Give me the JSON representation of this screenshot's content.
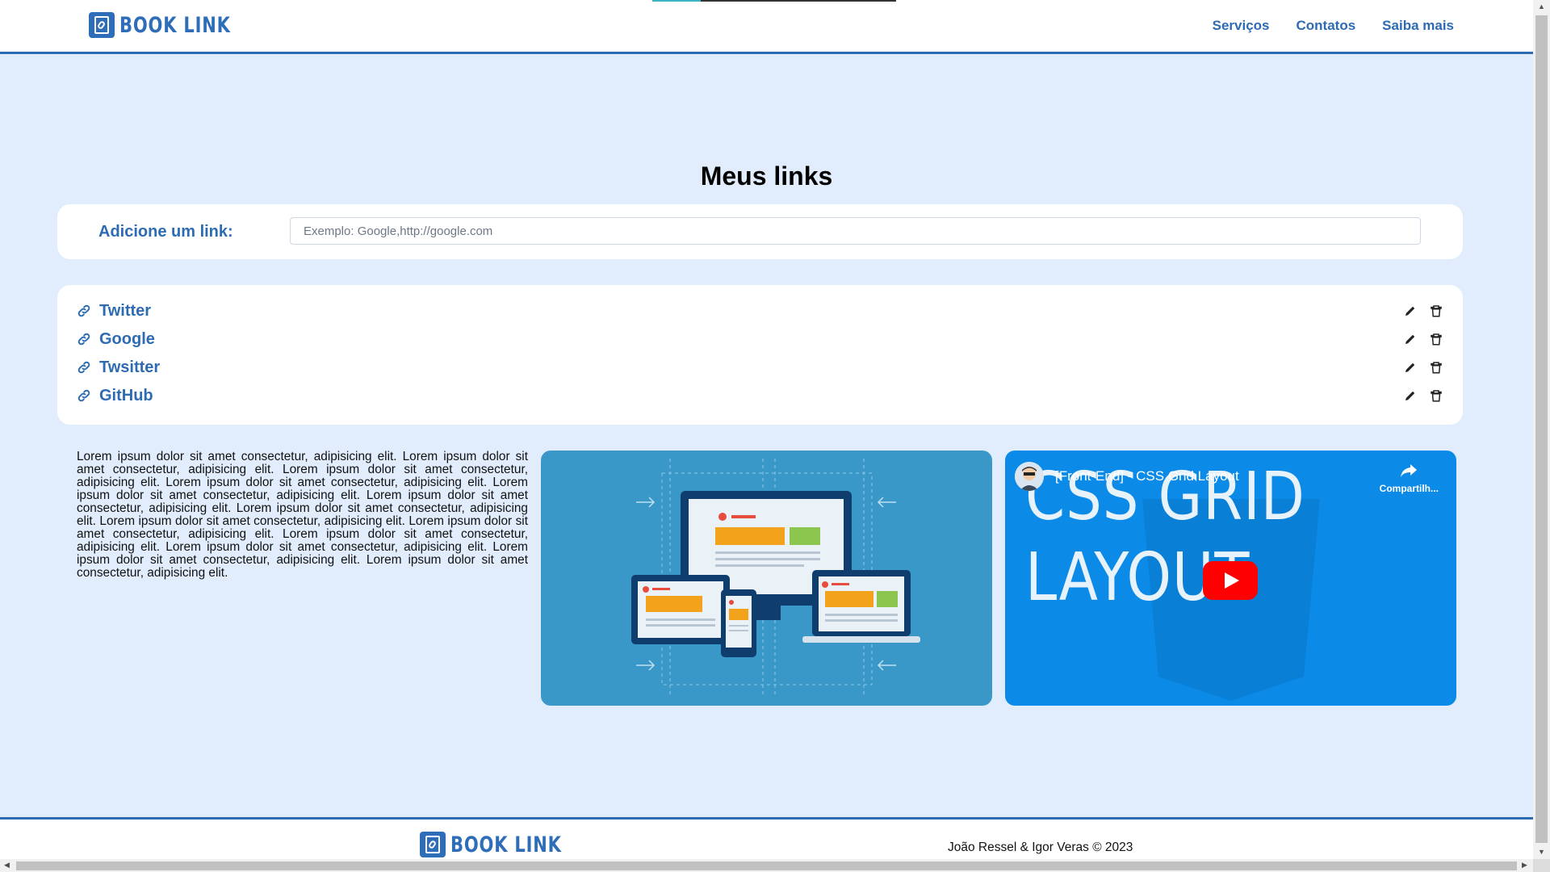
{
  "header": {
    "logo_text": "BOOK LINK",
    "nav": [
      {
        "label": "Serviços"
      },
      {
        "label": "Contatos"
      },
      {
        "label": "Saiba mais"
      }
    ]
  },
  "main": {
    "title": "Meus links",
    "add": {
      "label": "Adicione um link:",
      "placeholder": "Exemplo: Google,http://google.com"
    },
    "links": [
      {
        "label": "Twitter"
      },
      {
        "label": "Google"
      },
      {
        "label": "Twsitter"
      },
      {
        "label": "GitHub"
      }
    ],
    "lorem": "Lorem ipsum dolor sit amet consectetur, adipisicing elit. Lorem ipsum dolor sit amet consectetur, adipisicing elit. Lorem ipsum dolor sit amet consectetur, adipisicing elit. Lorem ipsum dolor sit amet consectetur, adipisicing elit. Lorem ipsum dolor sit amet consectetur, adipisicing elit. Lorem ipsum dolor sit amet consectetur, adipisicing elit. Lorem ipsum dolor sit amet consectetur, adipisicing elit. Lorem ipsum dolor sit amet consectetur, adipisicing elit. Lorem ipsum dolor sit amet consectetur, adipisicing elit. Lorem ipsum dolor sit amet consectetur, adipisicing elit. Lorem ipsum dolor sit amet consectetur, adipisicing elit. Lorem ipsum dolor sit amet consectetur, adipisicing elit. Lorem ipsum dolor sit amet consectetur, adipisicing elit.",
    "video": {
      "title": "[Front-End] - CSS Grid Layout",
      "share_label": "Compartilh...",
      "thumb_line1": "CSS GRID",
      "thumb_line2": "LAYOUT"
    }
  },
  "footer": {
    "logo_text": "BOOK LINK",
    "credit": "João Ressel & Igor Veras © 2023"
  },
  "icons": {
    "link": "link-chain-icon",
    "edit": "pencil-icon",
    "delete": "trash-icon"
  },
  "colors": {
    "brand": "#2d6bb3",
    "page_bg": "#e1edfc",
    "card_bg": "#ffffff"
  }
}
